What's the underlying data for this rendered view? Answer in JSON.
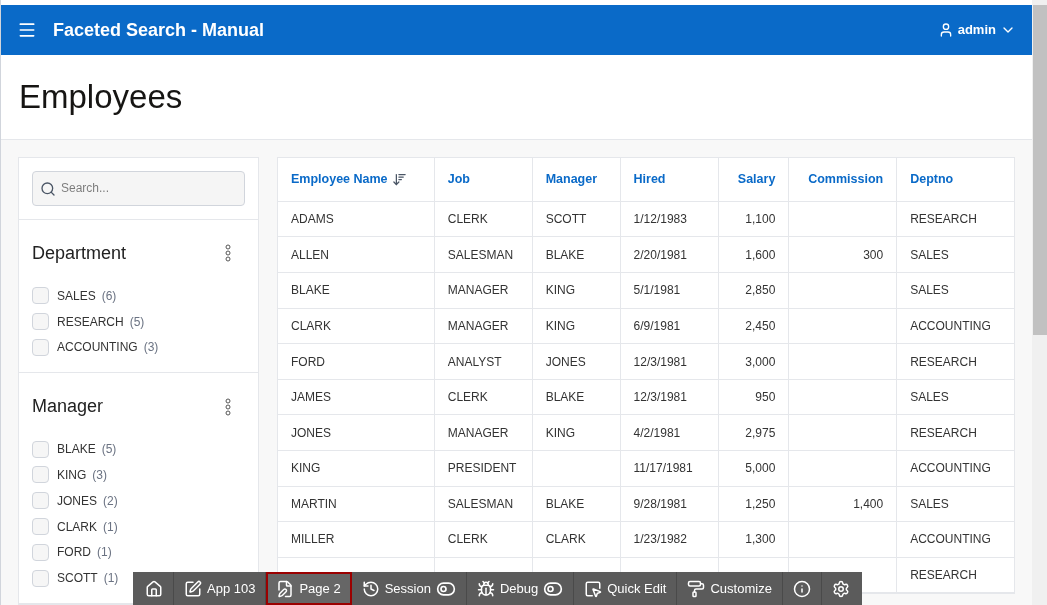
{
  "header": {
    "title": "Faceted Search - Manual",
    "user": "admin"
  },
  "page_title": "Employees",
  "search": {
    "placeholder": "Search..."
  },
  "facets": [
    {
      "title": "Department",
      "options": [
        {
          "label": "SALES",
          "count": "(6)",
          "checked": false
        },
        {
          "label": "RESEARCH",
          "count": "(5)",
          "checked": false
        },
        {
          "label": "ACCOUNTING",
          "count": "(3)",
          "checked": false
        }
      ]
    },
    {
      "title": "Manager",
      "options": [
        {
          "label": "BLAKE",
          "count": "(5)",
          "checked": false
        },
        {
          "label": "KING",
          "count": "(3)",
          "checked": false
        },
        {
          "label": "JONES",
          "count": "(2)",
          "checked": false
        },
        {
          "label": "CLARK",
          "count": "(1)",
          "checked": false
        },
        {
          "label": "FORD",
          "count": "(1)",
          "checked": false
        },
        {
          "label": "SCOTT",
          "count": "(1)",
          "checked": false
        }
      ]
    }
  ],
  "table": {
    "columns": [
      {
        "label": "Employee Name",
        "sorted": true
      },
      {
        "label": "Job",
        "sorted": false
      },
      {
        "label": "Manager",
        "sorted": false
      },
      {
        "label": "Hired",
        "sorted": false
      },
      {
        "label": "Salary",
        "sorted": false
      },
      {
        "label": "Commission",
        "sorted": false
      },
      {
        "label": "Deptno",
        "sorted": false
      }
    ],
    "rows": [
      [
        "ADAMS",
        "CLERK",
        "SCOTT",
        "1/12/1983",
        "1,100",
        null,
        "RESEARCH"
      ],
      [
        "ALLEN",
        "SALESMAN",
        "BLAKE",
        "2/20/1981",
        "1,600",
        "300",
        "SALES"
      ],
      [
        "BLAKE",
        "MANAGER",
        "KING",
        "5/1/1981",
        "2,850",
        null,
        "SALES"
      ],
      [
        "CLARK",
        "MANAGER",
        "KING",
        "6/9/1981",
        "2,450",
        null,
        "ACCOUNTING"
      ],
      [
        "FORD",
        "ANALYST",
        "JONES",
        "12/3/1981",
        "3,000",
        null,
        "RESEARCH"
      ],
      [
        "JAMES",
        "CLERK",
        "BLAKE",
        "12/3/1981",
        "950",
        null,
        "SALES"
      ],
      [
        "JONES",
        "MANAGER",
        "KING",
        "4/2/1981",
        "2,975",
        null,
        "RESEARCH"
      ],
      [
        "KING",
        "PRESIDENT",
        null,
        "11/17/1981",
        "5,000",
        null,
        "ACCOUNTING"
      ],
      [
        "MARTIN",
        "SALESMAN",
        "BLAKE",
        "9/28/1981",
        "1,250",
        "1,400",
        "SALES"
      ],
      [
        "MILLER",
        "CLERK",
        "CLARK",
        "1/23/1982",
        "1,300",
        null,
        "ACCOUNTING"
      ],
      [
        null,
        null,
        null,
        null,
        null,
        null,
        "RESEARCH"
      ]
    ]
  },
  "dev_toolbar": [
    {
      "kind": "home",
      "selected": false
    },
    {
      "kind": "app",
      "label": "App 103",
      "selected": false
    },
    {
      "kind": "page",
      "label": "Page 2",
      "selected": true
    },
    {
      "kind": "session",
      "label": "Session",
      "selected": false
    },
    {
      "kind": "debug",
      "label": "Debug",
      "selected": false
    },
    {
      "kind": "quickedit",
      "label": "Quick Edit",
      "selected": false
    },
    {
      "kind": "customize",
      "label": "Customize",
      "selected": false
    },
    {
      "kind": "info",
      "selected": false
    },
    {
      "kind": "settings",
      "selected": false
    }
  ]
}
